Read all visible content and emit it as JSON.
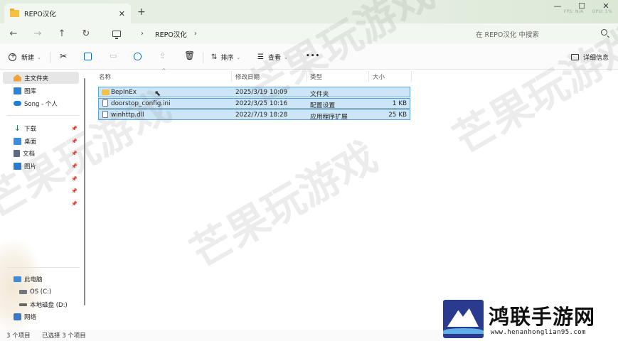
{
  "window": {
    "tab_title": "REPO汉化",
    "overlay": {
      "fps": "FPS: N/A",
      "gpu": "GPU: 1%"
    }
  },
  "address": {
    "breadcrumb": "REPO汉化",
    "search_placeholder": "在 REPO汉化 中搜索"
  },
  "toolbar": {
    "new_label": "新建",
    "sort_label": "排序",
    "view_label": "查看",
    "more_label": "•••",
    "details_label": "详细信息"
  },
  "sidebar": {
    "items": [
      {
        "label": "主文件夹",
        "icon": "home-icon"
      },
      {
        "label": "图库",
        "icon": "gallery-icon"
      },
      {
        "label": "Song - 个人",
        "icon": "onedrive-icon"
      },
      {
        "label": "下载",
        "icon": "download-icon"
      },
      {
        "label": "桌面",
        "icon": "desktop-icon"
      },
      {
        "label": "文档",
        "icon": "documents-icon"
      },
      {
        "label": "图片",
        "icon": "pictures-icon"
      },
      {
        "label": "此电脑",
        "icon": "this-pc-icon"
      },
      {
        "label": "OS (C:)",
        "icon": "drive-icon"
      },
      {
        "label": "本地磁盘 (D:)",
        "icon": "drive-icon"
      },
      {
        "label": "网络",
        "icon": "network-icon"
      }
    ]
  },
  "columns": {
    "name": "名称",
    "date": "修改日期",
    "type": "类型",
    "size": "大小"
  },
  "files": [
    {
      "name": "BepInEx",
      "date": "2025/3/19 10:09",
      "type": "文件夹",
      "size": ""
    },
    {
      "name": "doorstop_config.ini",
      "date": "2022/3/25 10:16",
      "type": "配置设置",
      "size": "1 KB"
    },
    {
      "name": "winhttp.dll",
      "date": "2022/7/19 18:28",
      "type": "应用程序扩展",
      "size": "25 KB"
    }
  ],
  "status": {
    "count": "3 个项目",
    "selected": "已选择 3 个项目"
  },
  "watermark": {
    "text": "芒果玩游戏"
  },
  "logo": {
    "name": "鸿联手游网",
    "url": "www.henanhonglian95.com"
  }
}
